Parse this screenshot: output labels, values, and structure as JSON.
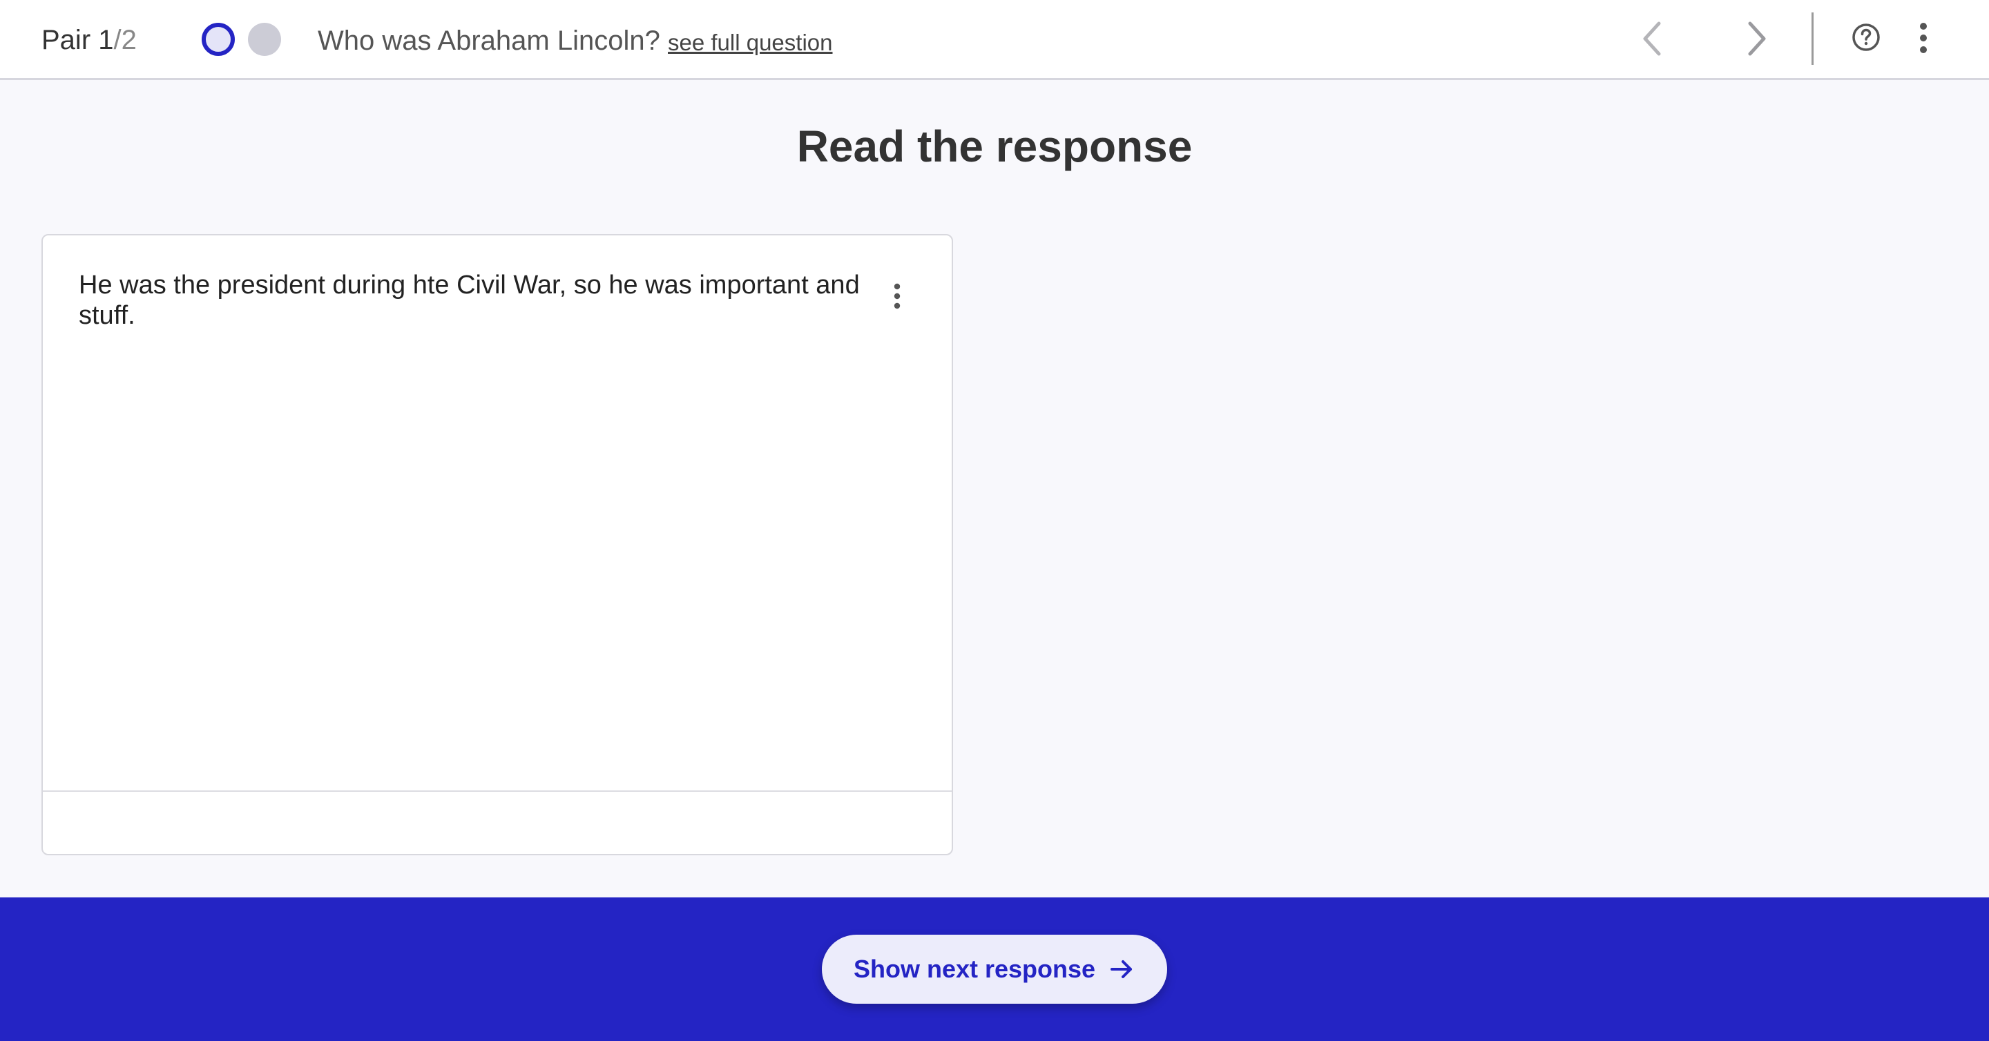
{
  "header": {
    "pair_prefix": "Pair 1",
    "pair_total": "/2",
    "question": "Who was Abraham Lincoln?",
    "see_full_link": "see full question",
    "progress": {
      "current": 1,
      "total": 2
    }
  },
  "main": {
    "title": "Read the response",
    "response_text": "He was the president during hte Civil War, so he was important and stuff."
  },
  "footer": {
    "next_button_label": "Show next response"
  },
  "colors": {
    "accent": "#2424c4",
    "page_bg": "#f8f8fc",
    "button_bg": "#ececfb"
  },
  "icons": {
    "prev": "chevron-left-icon",
    "next": "chevron-right-icon",
    "help": "question-circle-icon",
    "more": "kebab-menu-icon",
    "arrow": "arrow-right-icon"
  }
}
